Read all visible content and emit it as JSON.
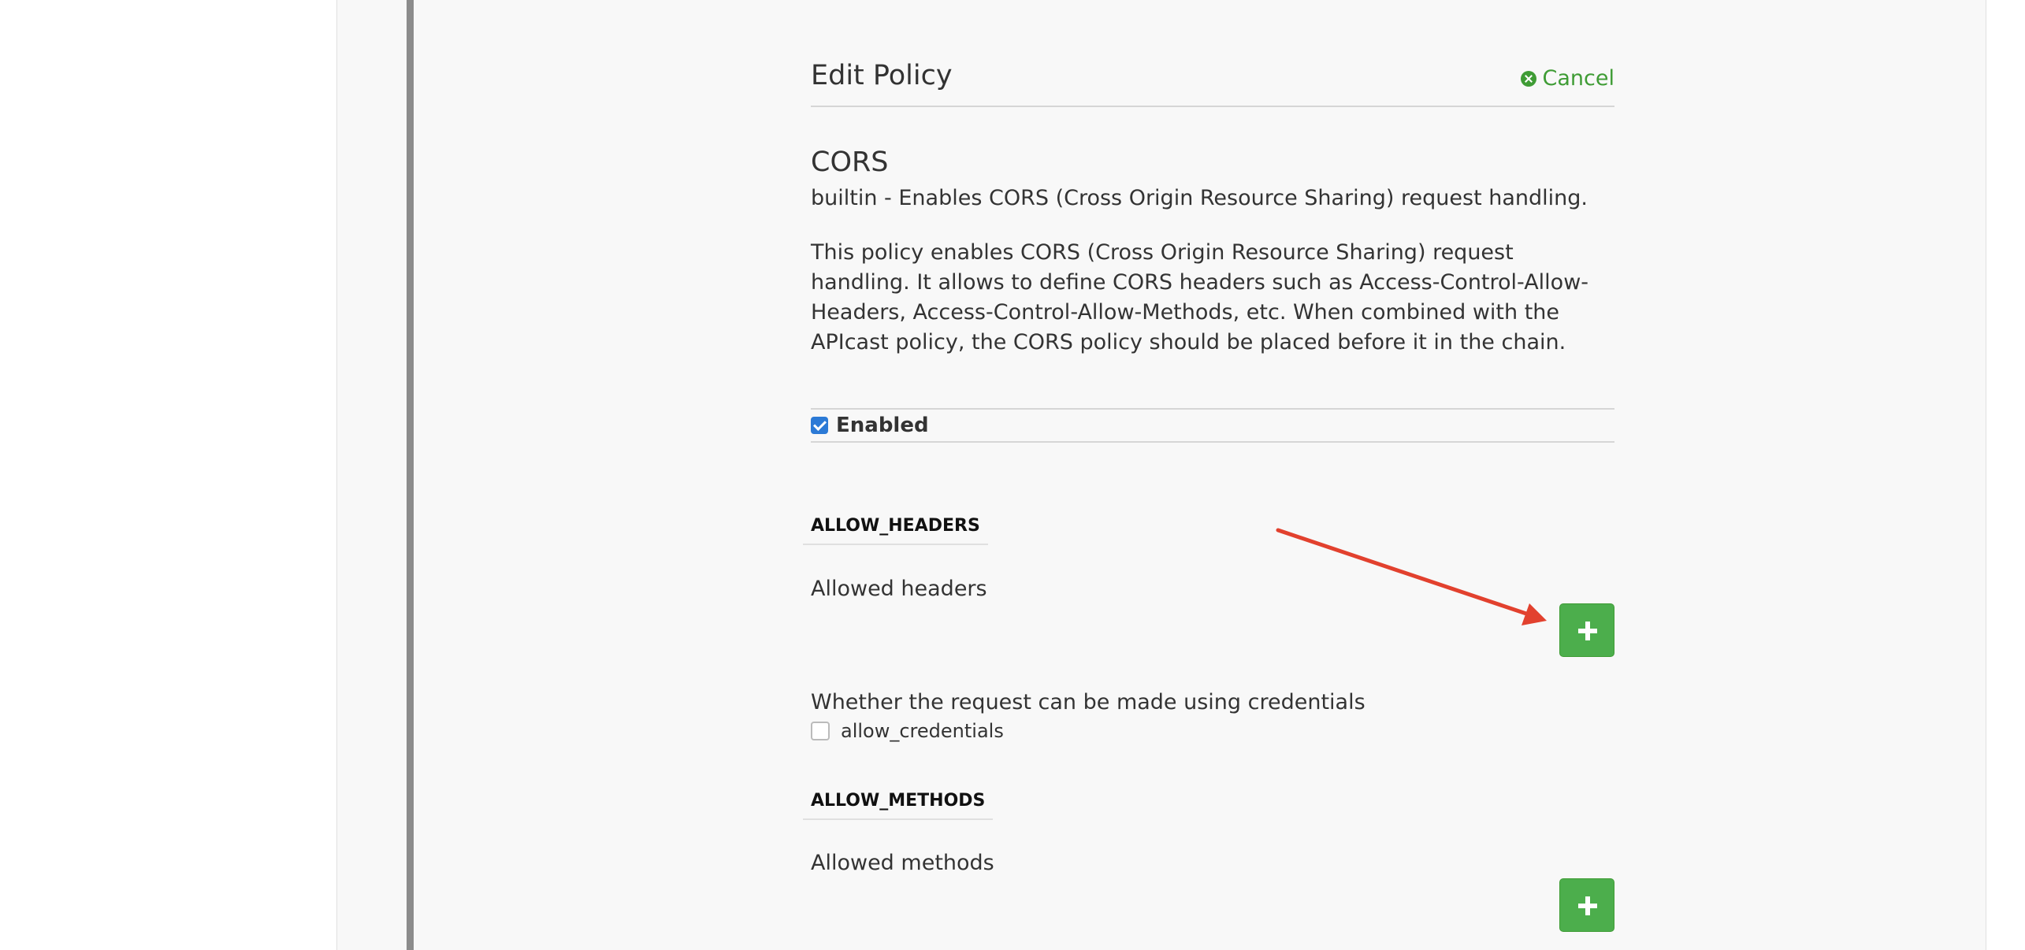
{
  "header": {
    "title": "Edit Policy",
    "cancel_label": "Cancel"
  },
  "policy": {
    "name": "CORS",
    "summary": "builtin - Enables CORS (Cross Origin Resource Sharing) request handling.",
    "description": "This policy enables CORS (Cross Origin Resource Sharing) request handling. It allows to define CORS headers such as Access-Control-Allow-Headers, Access-Control-Allow-Methods, etc. When combined with the APIcast policy, the CORS policy should be placed before it in the chain."
  },
  "enabled": {
    "label": "Enabled",
    "checked": true
  },
  "allow_headers": {
    "heading": "ALLOW_HEADERS",
    "description": "Allowed headers",
    "add_icon": "plus-icon"
  },
  "allow_credentials": {
    "title": "Whether the request can be made using credentials",
    "label": "allow_credentials",
    "checked": false
  },
  "allow_methods": {
    "heading": "ALLOW_METHODS",
    "description": "Allowed methods",
    "add_icon": "plus-icon"
  },
  "colors": {
    "accent_green": "#3f9c35",
    "button_green": "#4cae4c",
    "annotation_arrow": "#e2412e",
    "checkbox_blue": "#2c7ad6"
  }
}
